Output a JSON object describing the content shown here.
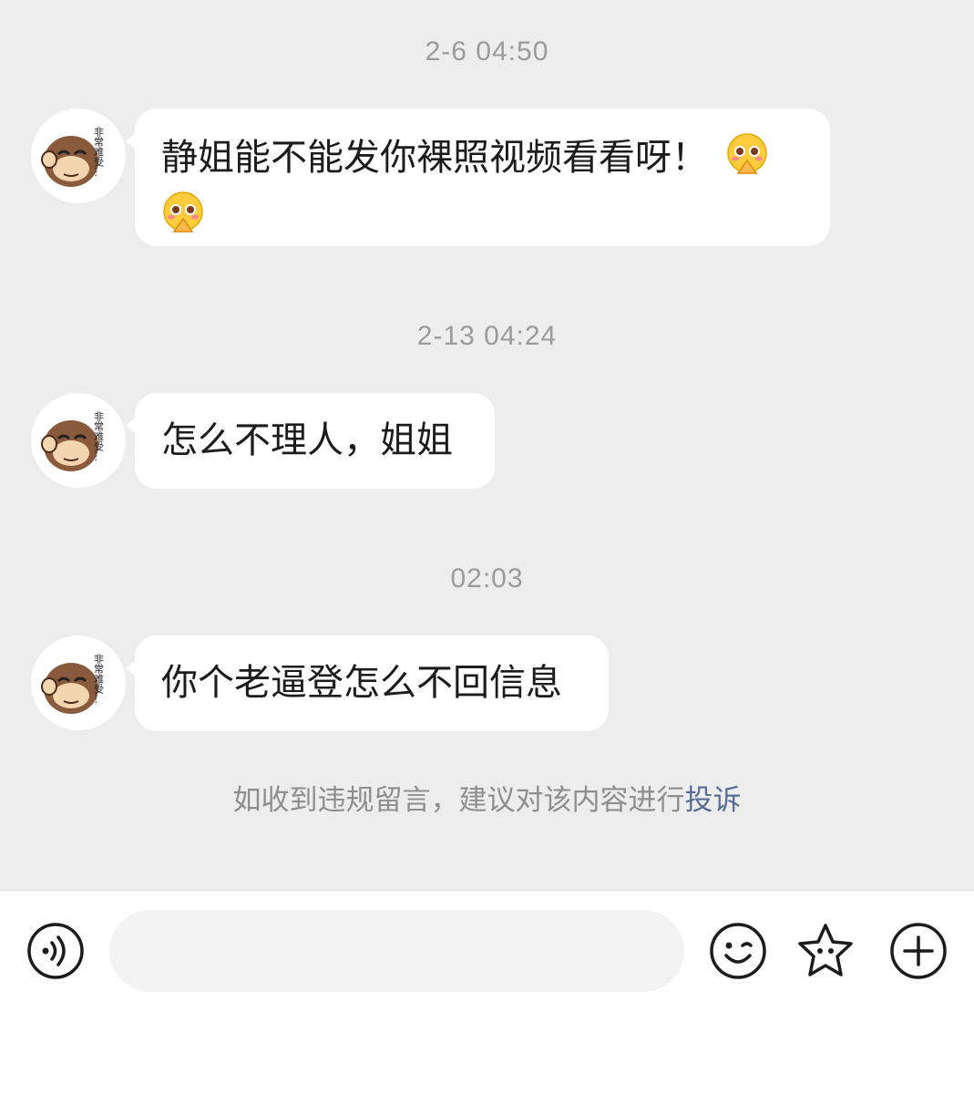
{
  "messages": [
    {
      "time": "2-6 04:50",
      "text_line1": "静姐能不能发你裸照视频看看呀！",
      "emoji": "pleading-face-icon"
    },
    {
      "time": "2-13 04:24",
      "text": "怎么不理人，姐姐"
    },
    {
      "time": "02:03",
      "text": "你个老逼登怎么不回信息"
    }
  ],
  "avatar_caption": "非常难受…",
  "notice": {
    "text": "如收到违规留言，建议对该内容进行",
    "link": "投诉"
  },
  "input_bar": {
    "voice_icon": "voice-icon",
    "placeholder": "",
    "emoji_icon": "smiley-face-icon",
    "sticker_icon": "star-sticker-icon",
    "plus_icon": "plus-circle-icon"
  },
  "colors": {
    "background": "#ededed",
    "bubble": "#ffffff",
    "link": "#576b95",
    "timestamp": "#9b9b9b"
  }
}
